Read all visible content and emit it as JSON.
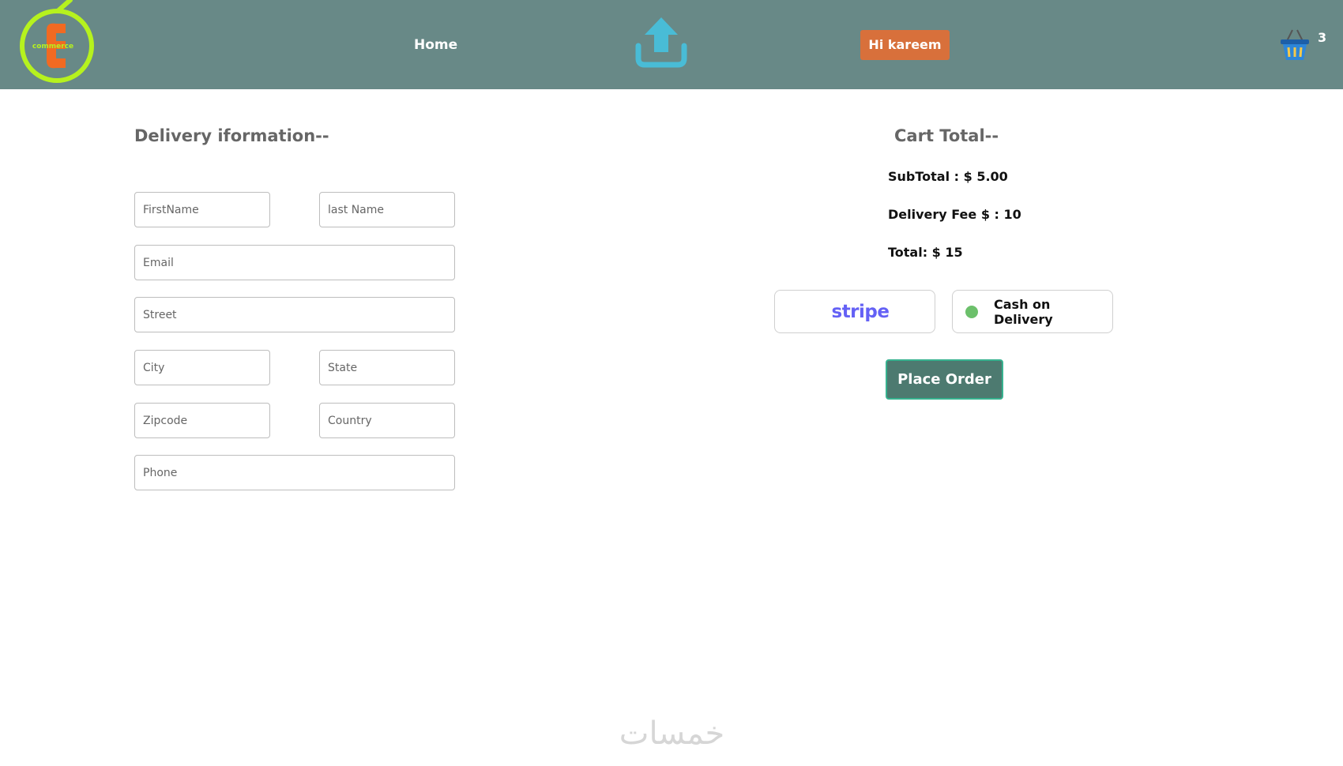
{
  "navbar": {
    "logo_text": "commerce",
    "home_label": "Home",
    "upload_icon": "upload-icon",
    "greeting": "Hi kareem",
    "cart_icon": "basket-icon",
    "cart_count": "3",
    "bg_color": "#688987",
    "greeting_color": "#d8703b"
  },
  "delivery": {
    "title": "Delivery iformation--",
    "fields": {
      "first_name": "FirstName",
      "last_name": "last Name",
      "email": "Email",
      "street": "Street",
      "city": "City",
      "state": "State",
      "zipcode": "Zipcode",
      "country": "Country",
      "phone": "Phone"
    }
  },
  "cart_total": {
    "title": "Cart Total--",
    "subtotal": "SubTotal : $ 5.00",
    "delivery_fee": "Delivery Fee $ : 10",
    "total": "Total: $ 15"
  },
  "payment": {
    "stripe_label": "stripe",
    "cod_label": "Cash on Delivery",
    "selected": "Cash on Delivery",
    "stripe_color": "#6461f5",
    "selected_dot_color": "#6cc06b"
  },
  "place_order_label": "Place Order",
  "watermark": "خمسات"
}
